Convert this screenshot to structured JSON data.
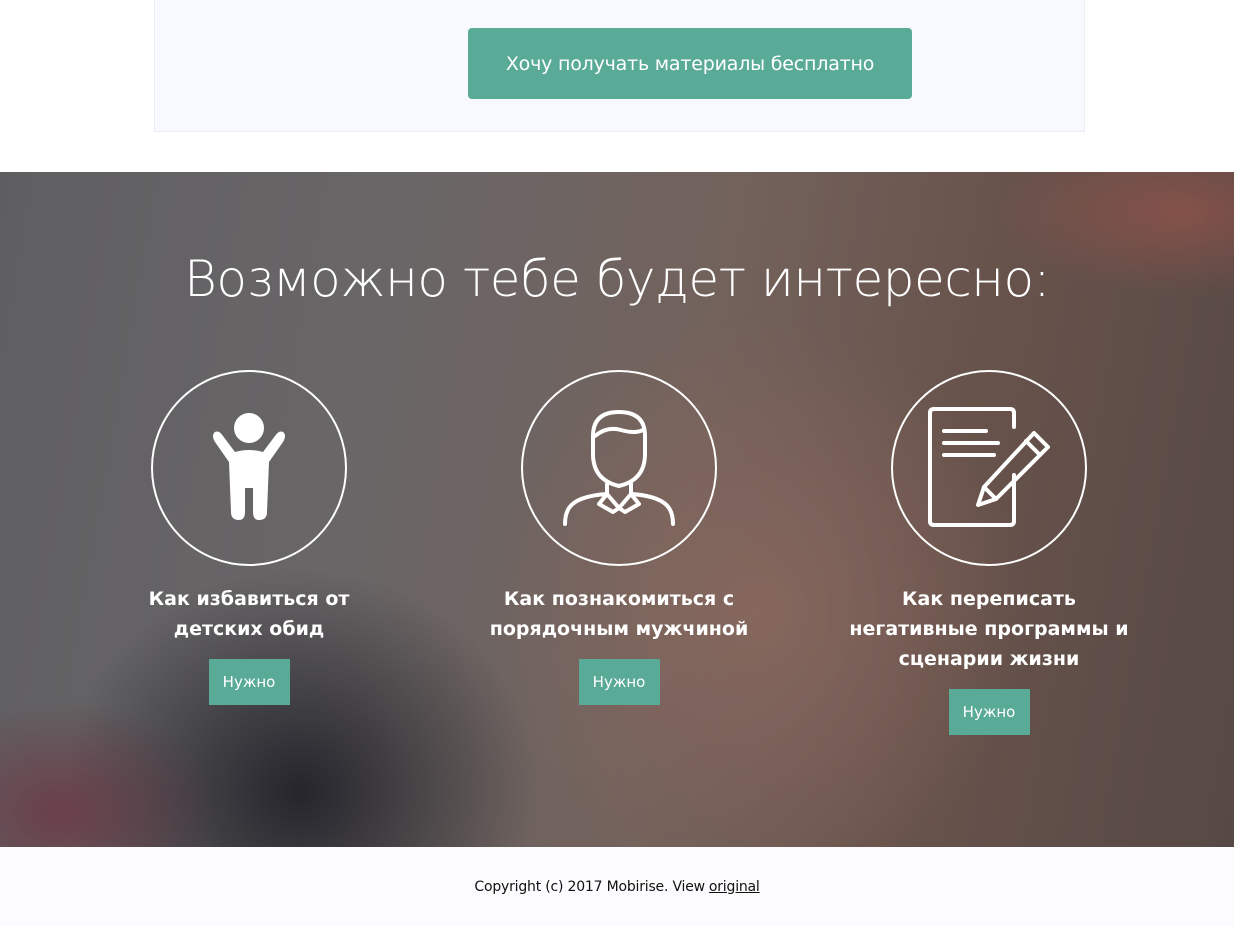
{
  "cta": {
    "button_label": "Хочу получать материалы бесплатно"
  },
  "hero": {
    "title": "Возможно тебе будет интересно:",
    "cards": [
      {
        "icon": "child-icon",
        "title": "Как избавиться от детских обид",
        "button_label": "Нужно"
      },
      {
        "icon": "man-icon",
        "title": "Как познакомиться с порядочным мужчиной",
        "button_label": "Нужно"
      },
      {
        "icon": "document-edit-icon",
        "title": "Как переписать негативные программы и сценарии жизни",
        "button_label": "Нужно"
      }
    ]
  },
  "footer": {
    "copyright_text": "Copyright (c) 2017 Mobirise. View",
    "link_text": "original"
  },
  "colors": {
    "accent": "#5aaa98",
    "panel_bg": "#f8f9fe",
    "footer_bg": "#fcfcfe"
  }
}
